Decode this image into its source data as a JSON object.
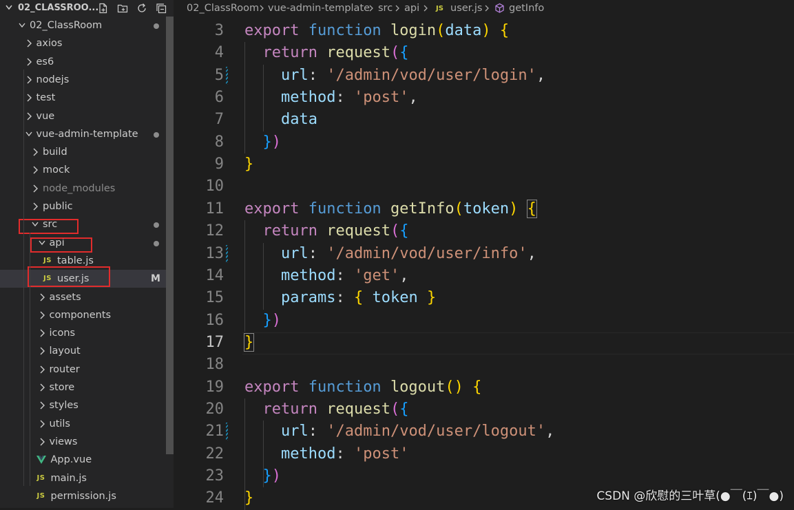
{
  "explorer": {
    "root_title": "02_CLASSROO...",
    "toolbar_icons": [
      "new-file-icon",
      "new-folder-icon",
      "refresh-icon",
      "collapse-all-icon"
    ],
    "tree": [
      {
        "label": "02_ClassRoom",
        "kind": "folder",
        "open": true,
        "depth": 0,
        "dot": true
      },
      {
        "label": "axios",
        "kind": "folder",
        "open": false,
        "depth": 1
      },
      {
        "label": "es6",
        "kind": "folder",
        "open": false,
        "depth": 1
      },
      {
        "label": "nodejs",
        "kind": "folder",
        "open": false,
        "depth": 1
      },
      {
        "label": "test",
        "kind": "folder",
        "open": false,
        "depth": 1
      },
      {
        "label": "vue",
        "kind": "folder",
        "open": false,
        "depth": 1
      },
      {
        "label": "vue-admin-template",
        "kind": "folder",
        "open": true,
        "depth": 1,
        "dot": true
      },
      {
        "label": "build",
        "kind": "folder",
        "open": false,
        "depth": 2
      },
      {
        "label": "mock",
        "kind": "folder",
        "open": false,
        "depth": 2
      },
      {
        "label": "node_modules",
        "kind": "folder",
        "open": false,
        "depth": 2,
        "dim": true
      },
      {
        "label": "public",
        "kind": "folder",
        "open": false,
        "depth": 2
      },
      {
        "label": "src",
        "kind": "folder",
        "open": true,
        "depth": 2,
        "dot": true,
        "highlight": true
      },
      {
        "label": "api",
        "kind": "folder",
        "open": true,
        "depth": 3,
        "dot": true,
        "highlight": true
      },
      {
        "label": "table.js",
        "kind": "js",
        "depth": 4
      },
      {
        "label": "user.js",
        "kind": "js",
        "depth": 4,
        "selected": true,
        "status": "M",
        "highlight": true
      },
      {
        "label": "assets",
        "kind": "folder",
        "open": false,
        "depth": 3
      },
      {
        "label": "components",
        "kind": "folder",
        "open": false,
        "depth": 3
      },
      {
        "label": "icons",
        "kind": "folder",
        "open": false,
        "depth": 3
      },
      {
        "label": "layout",
        "kind": "folder",
        "open": false,
        "depth": 3
      },
      {
        "label": "router",
        "kind": "folder",
        "open": false,
        "depth": 3
      },
      {
        "label": "store",
        "kind": "folder",
        "open": false,
        "depth": 3
      },
      {
        "label": "styles",
        "kind": "folder",
        "open": false,
        "depth": 3
      },
      {
        "label": "utils",
        "kind": "folder",
        "open": false,
        "depth": 3
      },
      {
        "label": "views",
        "kind": "folder",
        "open": false,
        "depth": 3
      },
      {
        "label": "App.vue",
        "kind": "vue",
        "depth": 3
      },
      {
        "label": "main.js",
        "kind": "js",
        "depth": 3
      },
      {
        "label": "permission.js",
        "kind": "js",
        "depth": 3
      }
    ]
  },
  "breadcrumb": {
    "items": [
      "02_ClassRoom",
      "vue-admin-template",
      "src",
      "api",
      "user.js",
      "getInfo"
    ],
    "file_badge": "JS"
  },
  "editor": {
    "active_line": 17,
    "lines": [
      {
        "n": "3",
        "tokens": [
          [
            "kw",
            "export "
          ],
          [
            "st",
            "function "
          ],
          [
            "fn",
            "login"
          ],
          [
            "b1",
            "("
          ],
          [
            "va",
            "data"
          ],
          [
            "b1",
            ")"
          ],
          [
            "pu",
            " "
          ],
          [
            "b1",
            "{"
          ]
        ]
      },
      {
        "n": "4",
        "tokens": [
          [
            "pu",
            "  "
          ],
          [
            "kw",
            "return "
          ],
          [
            "fn",
            "request"
          ],
          [
            "b2",
            "("
          ],
          [
            "b3",
            "{"
          ]
        ]
      },
      {
        "n": "5",
        "mod": true,
        "tokens": [
          [
            "pu",
            "    "
          ],
          [
            "pr",
            "url"
          ],
          [
            "pu",
            ": "
          ],
          [
            "str",
            "'/admin/vod/user/login'"
          ],
          [
            "pu",
            ","
          ]
        ]
      },
      {
        "n": "6",
        "tokens": [
          [
            "pu",
            "    "
          ],
          [
            "pr",
            "method"
          ],
          [
            "pu",
            ": "
          ],
          [
            "str",
            "'post'"
          ],
          [
            "pu",
            ","
          ]
        ]
      },
      {
        "n": "7",
        "tokens": [
          [
            "pu",
            "    "
          ],
          [
            "va",
            "data"
          ]
        ]
      },
      {
        "n": "8",
        "tokens": [
          [
            "pu",
            "  "
          ],
          [
            "b3",
            "}"
          ],
          [
            "b2",
            ")"
          ]
        ]
      },
      {
        "n": "9",
        "tokens": [
          [
            "b1",
            "}"
          ]
        ]
      },
      {
        "n": "10",
        "tokens": []
      },
      {
        "n": "11",
        "tokens": [
          [
            "kw",
            "export "
          ],
          [
            "st",
            "function "
          ],
          [
            "fn",
            "getInfo"
          ],
          [
            "b1",
            "("
          ],
          [
            "va",
            "token"
          ],
          [
            "b1",
            ")"
          ],
          [
            "pu",
            " "
          ],
          [
            "b1",
            "{",
            "box"
          ]
        ]
      },
      {
        "n": "12",
        "tokens": [
          [
            "pu",
            "  "
          ],
          [
            "kw",
            "return "
          ],
          [
            "fn",
            "request"
          ],
          [
            "b2",
            "("
          ],
          [
            "b3",
            "{"
          ]
        ]
      },
      {
        "n": "13",
        "mod": true,
        "tokens": [
          [
            "pu",
            "    "
          ],
          [
            "pr",
            "url"
          ],
          [
            "pu",
            ": "
          ],
          [
            "str",
            "'/admin/vod/user/info'"
          ],
          [
            "pu",
            ","
          ]
        ]
      },
      {
        "n": "14",
        "tokens": [
          [
            "pu",
            "    "
          ],
          [
            "pr",
            "method"
          ],
          [
            "pu",
            ": "
          ],
          [
            "str",
            "'get'"
          ],
          [
            "pu",
            ","
          ]
        ]
      },
      {
        "n": "15",
        "tokens": [
          [
            "pu",
            "    "
          ],
          [
            "pr",
            "params"
          ],
          [
            "pu",
            ": "
          ],
          [
            "b1",
            "{"
          ],
          [
            "pu",
            " "
          ],
          [
            "va",
            "token"
          ],
          [
            "pu",
            " "
          ],
          [
            "b1",
            "}"
          ]
        ]
      },
      {
        "n": "16",
        "tokens": [
          [
            "pu",
            "  "
          ],
          [
            "b3",
            "}"
          ],
          [
            "b2",
            ")"
          ]
        ]
      },
      {
        "n": "17",
        "tokens": [
          [
            "b1",
            "}",
            "box"
          ]
        ]
      },
      {
        "n": "18",
        "tokens": []
      },
      {
        "n": "19",
        "tokens": [
          [
            "kw",
            "export "
          ],
          [
            "st",
            "function "
          ],
          [
            "fn",
            "logout"
          ],
          [
            "b1",
            "()"
          ],
          [
            "pu",
            " "
          ],
          [
            "b1",
            "{"
          ]
        ]
      },
      {
        "n": "20",
        "tokens": [
          [
            "pu",
            "  "
          ],
          [
            "kw",
            "return "
          ],
          [
            "fn",
            "request"
          ],
          [
            "b2",
            "("
          ],
          [
            "b3",
            "{"
          ]
        ]
      },
      {
        "n": "21",
        "mod": true,
        "tokens": [
          [
            "pu",
            "    "
          ],
          [
            "pr",
            "url"
          ],
          [
            "pu",
            ": "
          ],
          [
            "str",
            "'/admin/vod/user/logout'"
          ],
          [
            "pu",
            ","
          ]
        ]
      },
      {
        "n": "22",
        "tokens": [
          [
            "pu",
            "    "
          ],
          [
            "pr",
            "method"
          ],
          [
            "pu",
            ": "
          ],
          [
            "str",
            "'post'"
          ]
        ]
      },
      {
        "n": "23",
        "tokens": [
          [
            "pu",
            "  "
          ],
          [
            "b3",
            "}"
          ],
          [
            "b2",
            ")"
          ]
        ]
      },
      {
        "n": "24",
        "tokens": [
          [
            "b1",
            "}"
          ]
        ]
      }
    ]
  },
  "watermark": "CSDN @欣慰的三叶草(●￣(ｴ)￣●)",
  "colors": {
    "keyword": "#c586c0",
    "storage": "#569cd6",
    "function": "#dcdcaa",
    "variable": "#9cdcfe",
    "string": "#ce9178",
    "bracket1": "#ffd700",
    "bracket2": "#da70d6",
    "bracket3": "#179fff",
    "highlight_box": "#e22c2c",
    "js_badge": "#cbcb41"
  }
}
